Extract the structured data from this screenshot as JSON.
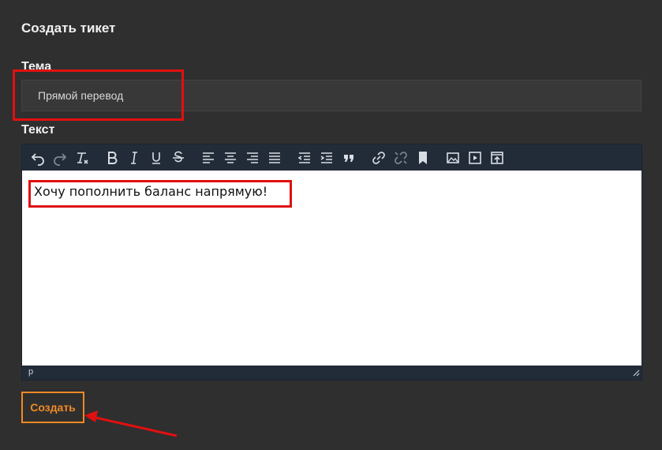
{
  "form": {
    "title": "Создать тикет",
    "subject_label": "Тема",
    "subject_value": "Прямой перевод",
    "text_label": "Текст",
    "body_text": "Хочу пополнить баланс напрямую!",
    "statusbar_path": "p",
    "submit_label": "Создать"
  },
  "toolbar": {
    "icons": [
      "undo-icon",
      "redo-icon",
      "clear-format-icon",
      "bold-icon",
      "italic-icon",
      "underline-icon",
      "strikethrough-icon",
      "align-left-icon",
      "align-center-icon",
      "align-right-icon",
      "align-justify-icon",
      "outdent-icon",
      "indent-icon",
      "blockquote-icon",
      "link-icon",
      "unlink-icon",
      "anchor-icon",
      "image-icon",
      "media-icon",
      "template-icon"
    ]
  },
  "colors": {
    "background": "#2f2f2f",
    "toolbar": "#222c39",
    "accent": "#f08a24",
    "annotation": "#e01010"
  }
}
